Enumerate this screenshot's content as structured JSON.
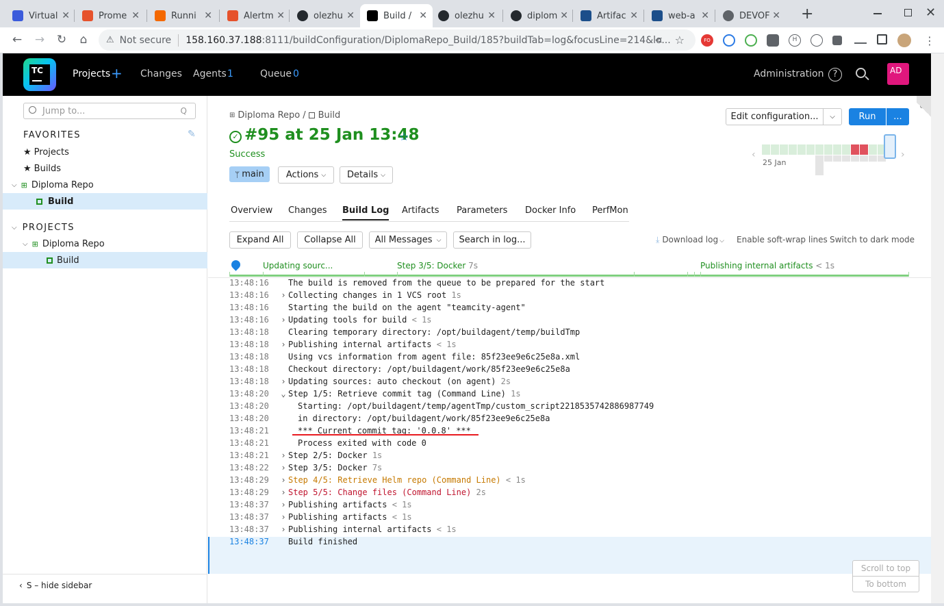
{
  "browser": {
    "tabs": [
      {
        "label": "Virtual",
        "icon": "youtrack-icon",
        "color": "#3b5bdb"
      },
      {
        "label": "Prome",
        "icon": "prometheus-icon",
        "color": "#e6522c"
      },
      {
        "label": "Runni",
        "icon": "grafana-icon",
        "color": "#f46800"
      },
      {
        "label": "Alertm",
        "icon": "prometheus-icon",
        "color": "#e6522c"
      },
      {
        "label": "olezhu",
        "icon": "github-icon",
        "color": "#24292e"
      },
      {
        "label": "Build /",
        "icon": "teamcity-icon",
        "color": "#000000"
      },
      {
        "label": "olezhu",
        "icon": "github-icon",
        "color": "#24292e"
      },
      {
        "label": "diplom",
        "icon": "github-icon",
        "color": "#24292e"
      },
      {
        "label": "Artifac",
        "icon": "box-icon",
        "color": "#1c4e8a"
      },
      {
        "label": "web-a",
        "icon": "box-icon",
        "color": "#1c4e8a"
      },
      {
        "label": "DEVOF",
        "icon": "globe-icon",
        "color": "#5f6368"
      }
    ],
    "new_tab": "+",
    "security": "Not secure",
    "url_host": "158.160.37.188",
    "url_rest": ":8111/buildConfiguration/DiplomaRepo_Build/185?buildTab=log&focusLine=214&lo..."
  },
  "header": {
    "logo": "TC",
    "projects": "Projects",
    "plus": "+",
    "changes": "Changes",
    "agents": "Agents",
    "agents_count": "1",
    "queue": "Queue",
    "queue_count": "0",
    "administration": "Administration",
    "avatar": "AD"
  },
  "sidebar": {
    "search_placeholder": "Jump to...",
    "favorites_title": "FAVORITES",
    "fav_projects": "Projects",
    "fav_builds": "Builds",
    "fav_repo": "Diploma Repo",
    "fav_build": "Build",
    "projects_title": "PROJECTS",
    "proj_repo": "Diploma Repo",
    "proj_build": "Build",
    "hide": "S – hide sidebar"
  },
  "build": {
    "breadcrumb_project": "Diploma Repo",
    "breadcrumb_sep": "/",
    "breadcrumb_config": "Build",
    "title": "#95 at 25 Jan 13:48",
    "status": "Success",
    "branch": "main",
    "actions": "Actions",
    "details": "Details",
    "edit_config": "Edit configuration...",
    "run": "Run",
    "more": "...",
    "history_date": "25 Jan"
  },
  "tabs": [
    "Overview",
    "Changes",
    "Build Log",
    "Artifacts",
    "Parameters",
    "Docker Info",
    "PerfMon"
  ],
  "toolbar": {
    "expand": "Expand All",
    "collapse": "Collapse All",
    "messages": "All Messages",
    "search": "Search in log...",
    "download": "Download log",
    "softwrap": "Enable soft-wrap lines",
    "darkmode": "Switch to dark mode"
  },
  "timeline": {
    "step1": "Updating sourc...",
    "step2": "Step 3/5: Docker",
    "step2_dur": "7s",
    "step3": "Publishing internal artifacts",
    "step3_dur": "< 1s"
  },
  "log": [
    {
      "ts": "13:48:16",
      "arrow": "",
      "indent": 0,
      "msg": "The build is removed from the queue to be prepared for the start",
      "dur": "",
      "style": ""
    },
    {
      "ts": "13:48:16",
      "arrow": "›",
      "indent": 0,
      "msg": "Collecting changes in 1 VCS root",
      "dur": "1s",
      "style": ""
    },
    {
      "ts": "13:48:16",
      "arrow": "",
      "indent": 0,
      "msg": "Starting the build on the agent \"teamcity-agent\"",
      "dur": "",
      "style": ""
    },
    {
      "ts": "13:48:16",
      "arrow": "›",
      "indent": 0,
      "msg": "Updating tools for build",
      "dur": "< 1s",
      "style": ""
    },
    {
      "ts": "13:48:18",
      "arrow": "",
      "indent": 0,
      "msg": "Clearing temporary directory: /opt/buildagent/temp/buildTmp",
      "dur": "",
      "style": ""
    },
    {
      "ts": "13:48:18",
      "arrow": "›",
      "indent": 0,
      "msg": "Publishing internal artifacts",
      "dur": "< 1s",
      "style": ""
    },
    {
      "ts": "13:48:18",
      "arrow": "",
      "indent": 0,
      "msg": "Using vcs information from agent file: 85f23ee9e6c25e8a.xml",
      "dur": "",
      "style": ""
    },
    {
      "ts": "13:48:18",
      "arrow": "",
      "indent": 0,
      "msg": "Checkout directory: /opt/buildagent/work/85f23ee9e6c25e8a",
      "dur": "",
      "style": ""
    },
    {
      "ts": "13:48:18",
      "arrow": "›",
      "indent": 0,
      "msg": "Updating sources: auto checkout (on agent)",
      "dur": "2s",
      "style": ""
    },
    {
      "ts": "13:48:20",
      "arrow": "⌄",
      "indent": 0,
      "msg": "Step 1/5: Retrieve commit tag (Command Line)",
      "dur": "1s",
      "style": ""
    },
    {
      "ts": "13:48:20",
      "arrow": "",
      "indent": 1,
      "msg": "Starting: /opt/buildagent/temp/agentTmp/custom_script2218535742886987749",
      "dur": "",
      "style": ""
    },
    {
      "ts": "13:48:20",
      "arrow": "",
      "indent": 1,
      "msg": "in directory: /opt/buildagent/work/85f23ee9e6c25e8a",
      "dur": "",
      "style": ""
    },
    {
      "ts": "13:48:21",
      "arrow": "",
      "indent": 1,
      "msg": "*** Current commit tag: '0.0.8' ***",
      "dur": "",
      "style": "underline"
    },
    {
      "ts": "13:48:21",
      "arrow": "",
      "indent": 1,
      "msg": "Process exited with code 0",
      "dur": "",
      "style": ""
    },
    {
      "ts": "13:48:21",
      "arrow": "›",
      "indent": 0,
      "msg": "Step 2/5: Docker",
      "dur": "1s",
      "style": ""
    },
    {
      "ts": "13:48:22",
      "arrow": "›",
      "indent": 0,
      "msg": "Step 3/5: Docker",
      "dur": "7s",
      "style": ""
    },
    {
      "ts": "13:48:29",
      "arrow": "›",
      "indent": 0,
      "msg": "Step 4/5: Retrieve Helm repo (Command Line)",
      "dur": "< 1s",
      "style": "warn"
    },
    {
      "ts": "13:48:29",
      "arrow": "›",
      "indent": 0,
      "msg": "Step 5/5: Change files (Command Line)",
      "dur": "2s",
      "style": "err"
    },
    {
      "ts": "13:48:37",
      "arrow": "›",
      "indent": 0,
      "msg": "Publishing artifacts",
      "dur": "< 1s",
      "style": ""
    },
    {
      "ts": "13:48:37",
      "arrow": "›",
      "indent": 0,
      "msg": "Publishing artifacts",
      "dur": "< 1s",
      "style": ""
    },
    {
      "ts": "13:48:37",
      "arrow": "›",
      "indent": 0,
      "msg": "Publishing internal artifacts",
      "dur": "< 1s",
      "style": ""
    },
    {
      "ts": "13:48:37",
      "arrow": "",
      "indent": 0,
      "msg": "Build finished",
      "dur": "",
      "style": "focus"
    }
  ],
  "scroll": {
    "top": "Scroll to top",
    "bottom": "To bottom"
  },
  "colors": {
    "accent": "#1a82e2",
    "success": "#1f8f1f",
    "warn": "#c67900",
    "error": "#c0152f",
    "history_ok": "#d9eedb",
    "history_fail": "#e0525e"
  }
}
